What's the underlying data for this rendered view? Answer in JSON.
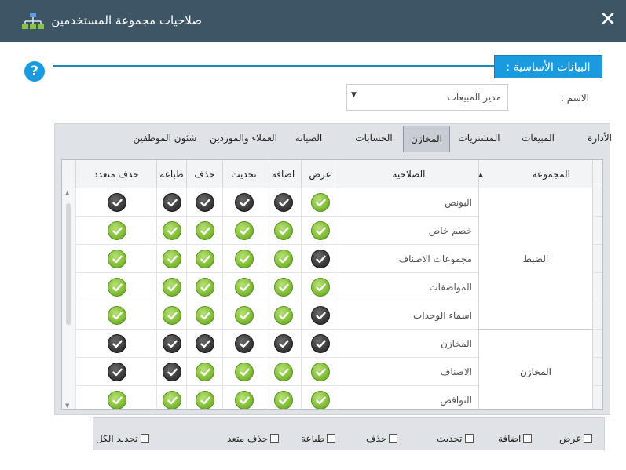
{
  "window": {
    "title": "صلاحيات مجموعة المستخدمين",
    "close_label": "✕"
  },
  "section": {
    "title": "البيانات الأساسية :",
    "help_label": "?"
  },
  "name_field": {
    "label": "الاسم :",
    "value": "مدير المبيعات"
  },
  "tabs": [
    {
      "label": "الأدارة",
      "active": false
    },
    {
      "label": "المبيعات",
      "active": false
    },
    {
      "label": "المشتريات",
      "active": false
    },
    {
      "label": "المخازن",
      "active": true
    },
    {
      "label": "الحسابات",
      "active": false
    },
    {
      "label": "الصيانة",
      "active": false
    },
    {
      "label": "العملاء والموردين",
      "active": false
    },
    {
      "label": "شئون الموظفين",
      "active": false
    }
  ],
  "grid": {
    "columns": {
      "group": "المجموعة",
      "permission": "الصلاحية",
      "view": "عرض",
      "add": "اضافة",
      "update": "تحديث",
      "delete": "حذف",
      "print": "طباعة",
      "multi_delete": "حذف متعدد"
    },
    "groups": [
      {
        "name": "الضبط",
        "row_count": 5
      },
      {
        "name": "المخازن",
        "row_count": 3
      }
    ],
    "rows": [
      {
        "permission": "البونص",
        "view": true,
        "add": false,
        "update": false,
        "delete": false,
        "print": false,
        "multi_delete": false
      },
      {
        "permission": "خصم خاص",
        "view": true,
        "add": true,
        "update": true,
        "delete": true,
        "print": true,
        "multi_delete": true
      },
      {
        "permission": "مجموعات الاصناف",
        "view": false,
        "add": true,
        "update": true,
        "delete": true,
        "print": true,
        "multi_delete": true
      },
      {
        "permission": "المواصفات",
        "view": true,
        "add": true,
        "update": true,
        "delete": true,
        "print": true,
        "multi_delete": true
      },
      {
        "permission": "اسماء الوحدات",
        "view": false,
        "add": true,
        "update": true,
        "delete": true,
        "print": true,
        "multi_delete": true
      },
      {
        "permission": "المخازن",
        "view": false,
        "add": false,
        "update": false,
        "delete": false,
        "print": false,
        "multi_delete": false
      },
      {
        "permission": "الاصناف",
        "view": true,
        "add": true,
        "update": true,
        "delete": true,
        "print": false,
        "multi_delete": false
      },
      {
        "permission": "النواقص",
        "view": true,
        "add": true,
        "update": true,
        "delete": true,
        "print": true,
        "multi_delete": true
      }
    ]
  },
  "bottom_checkboxes": {
    "view": "عرض",
    "add": "اضافة",
    "update": "تحديث",
    "delete": "حذف",
    "print": "طباعة",
    "multi_delete": "حذف متعد",
    "select_all": "تحديد الكل"
  },
  "colors": {
    "titlebar": "#3d5666",
    "accent": "#1a9be0",
    "check_on": "#86c23a",
    "check_off": "#3a3a3a"
  }
}
